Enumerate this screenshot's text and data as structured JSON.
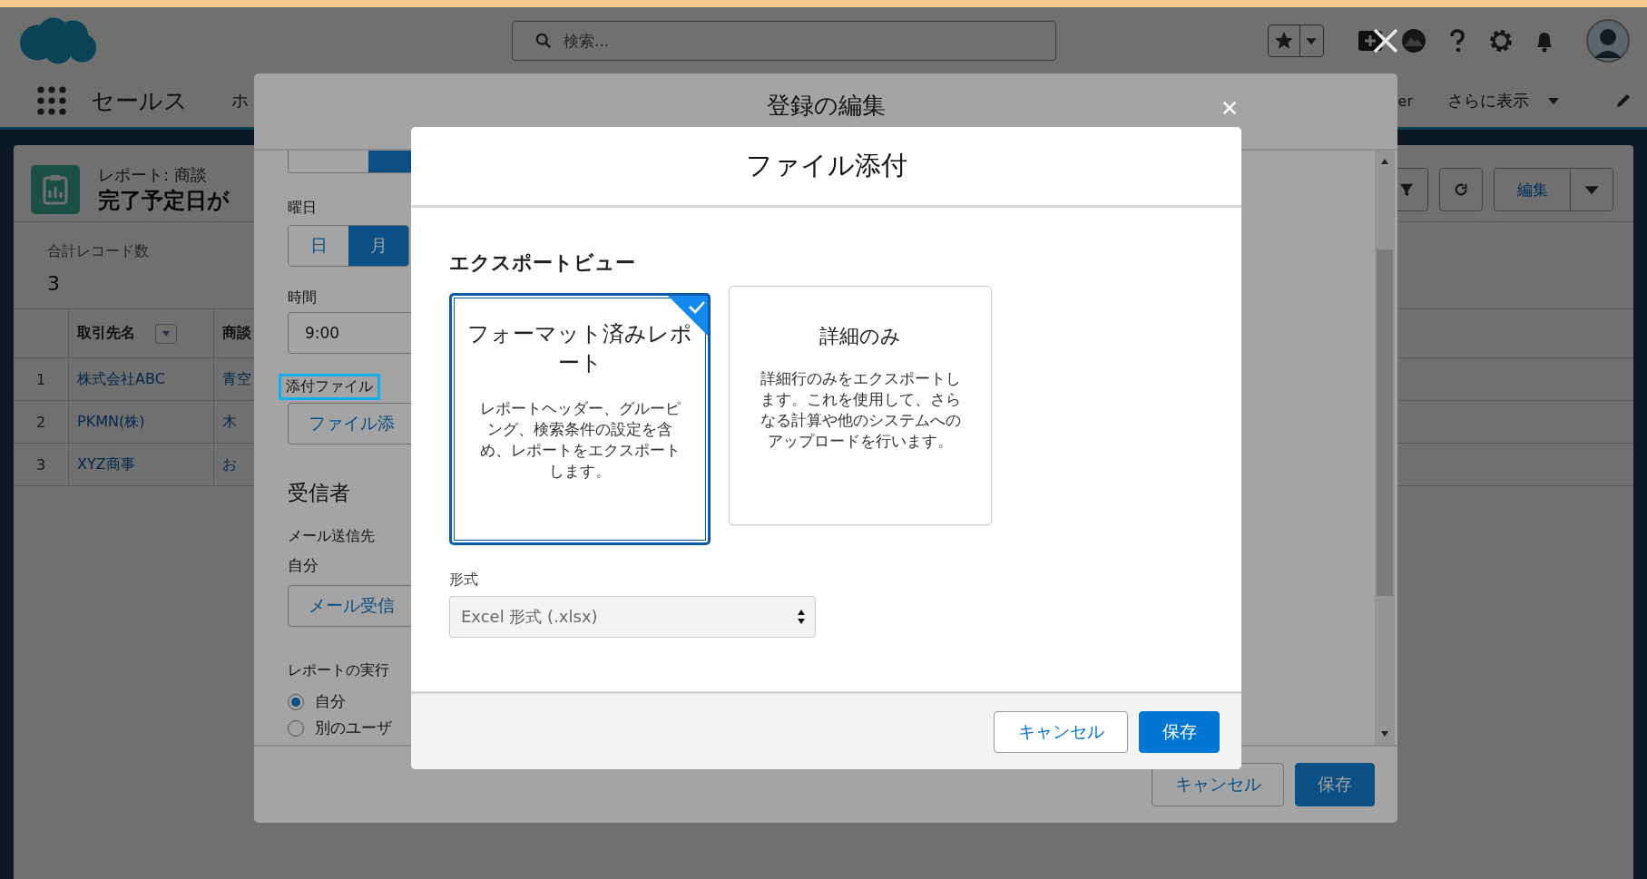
{
  "top_bar": {
    "search": {
      "placeholder": "検索..."
    }
  },
  "nav": {
    "app_name": "セールス",
    "items": [
      "ホ",
      "er"
    ],
    "more_label": "さらに表示"
  },
  "report": {
    "type_label": "レポート: 商談",
    "title": "完了予定日が",
    "edit_button": "編集",
    "total_label": "合計レコード数",
    "total": "3",
    "table": {
      "columns": [
        {
          "label": "取引先名",
          "sortable": true
        },
        {
          "label": "商談",
          "sortable": false
        }
      ],
      "rows": [
        {
          "number": "1",
          "cells": [
            "株式会社ABC",
            "青空"
          ]
        },
        {
          "number": "2",
          "cells": [
            "PKMN(株)",
            "木"
          ]
        },
        {
          "number": "3",
          "cells": [
            "XYZ商事",
            "お"
          ]
        }
      ]
    }
  },
  "edit_dialog": {
    "title": "登録の編集",
    "frequency_segments": [
      {
        "selected": false
      },
      {
        "selected": true
      }
    ],
    "weekday_label": "曜日",
    "weekdays": [
      {
        "label": "日",
        "selected": false
      },
      {
        "label": "月",
        "selected": true
      }
    ],
    "time_label": "時間",
    "time_value": "9:00",
    "attachment_label": "添付ファイル",
    "attachment_highlighted": true,
    "attachment_button": "ファイル添",
    "recipients_heading": "受信者",
    "email_to_label": "メール送信先",
    "email_to_value": "自分",
    "recipients_button": "メール受信",
    "run_as_label": "レポートの実行",
    "run_as_options": [
      {
        "label": "自分",
        "selected": true
      },
      {
        "label": "別のユーザ",
        "selected": false
      }
    ],
    "buttons": [
      {
        "label": "キャンセル",
        "kind": "neutral"
      },
      {
        "label": "保存",
        "kind": "brand"
      }
    ]
  },
  "file_dialog": {
    "title": "ファイル添付",
    "section_heading": "エクスポートビュー",
    "views": [
      {
        "title": "フォーマット済みレポート",
        "description": "レポートヘッダー、グルーピング、検索条件の設定を含め、レポートをエクスポートします。",
        "selected": true
      },
      {
        "title": "詳細のみ",
        "description": "詳細行のみをエクスポートします。これを使用して、さらなる計算や他のシステムへのアップロードを行います。",
        "selected": false
      }
    ],
    "format_label": "形式",
    "format_value": "Excel 形式 (.xlsx)",
    "buttons": [
      {
        "label": "キャンセル",
        "kind": "neutral"
      },
      {
        "label": "保存",
        "kind": "brand"
      }
    ]
  }
}
